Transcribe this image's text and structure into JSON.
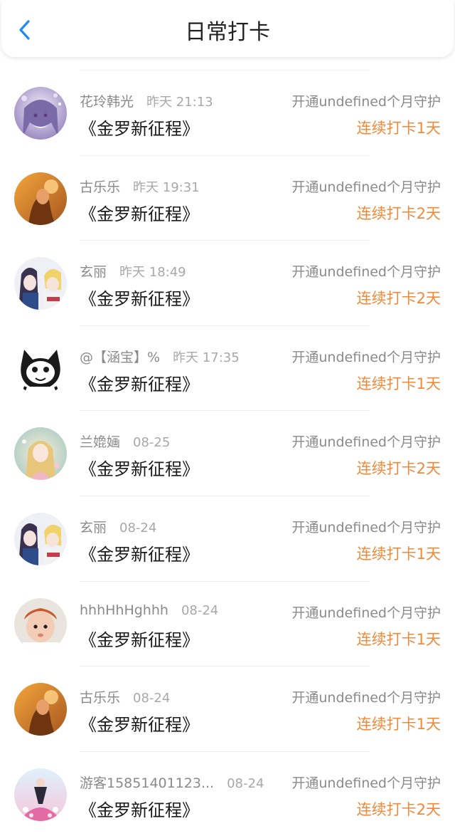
{
  "header": {
    "title": "日常打卡",
    "back_icon": "chevron-left-icon",
    "accent": "#1e8bf0"
  },
  "streak_color": "#f08a3a",
  "rows": [
    {
      "name": "花玲韩光",
      "time": "昨天 21:13",
      "book": "《金罗新征程》",
      "guard": "开通undefined个月守护",
      "streak": "连续打卡1天",
      "avatar": "anime-girl-purple"
    },
    {
      "name": "古乐乐",
      "time": "昨天 19:31",
      "book": "《金罗新征程》",
      "guard": "开通undefined个月守护",
      "streak": "连续打卡2天",
      "avatar": "sunset-girl"
    },
    {
      "name": "玄丽",
      "time": "昨天 18:49",
      "book": "《金罗新征程》",
      "guard": "开通undefined个月守护",
      "streak": "连续打卡2天",
      "avatar": "anime-couple"
    },
    {
      "name": "@【涵宝】%",
      "time": "昨天 17:35",
      "book": "《金罗新征程》",
      "guard": "开通undefined个月守护",
      "streak": "连续打卡1天",
      "avatar": "cartoon-cat"
    },
    {
      "name": "兰嫓婳",
      "time": "08-25",
      "book": "《金罗新征程》",
      "guard": "开通undefined个月守护",
      "streak": "连续打卡2天",
      "avatar": "pastel-girl"
    },
    {
      "name": "玄丽",
      "time": "08-24",
      "book": "《金罗新征程》",
      "guard": "开通undefined个月守护",
      "streak": "连续打卡1天",
      "avatar": "anime-couple"
    },
    {
      "name": "hhhHhHghhh",
      "time": "08-24",
      "book": "《金罗新征程》",
      "guard": "开通undefined个月守护",
      "streak": "连续打卡1天",
      "avatar": "baby-photo"
    },
    {
      "name": "古乐乐",
      "time": "08-24",
      "book": "《金罗新征程》",
      "guard": "开通undefined个月守护",
      "streak": "连续打卡1天",
      "avatar": "sunset-girl"
    },
    {
      "name": "游客15851401123...",
      "time": "08-24",
      "book": "《金罗新征程》",
      "guard": "开通undefined个月守护",
      "streak": "连续打卡2天",
      "avatar": "pink-figure"
    }
  ]
}
